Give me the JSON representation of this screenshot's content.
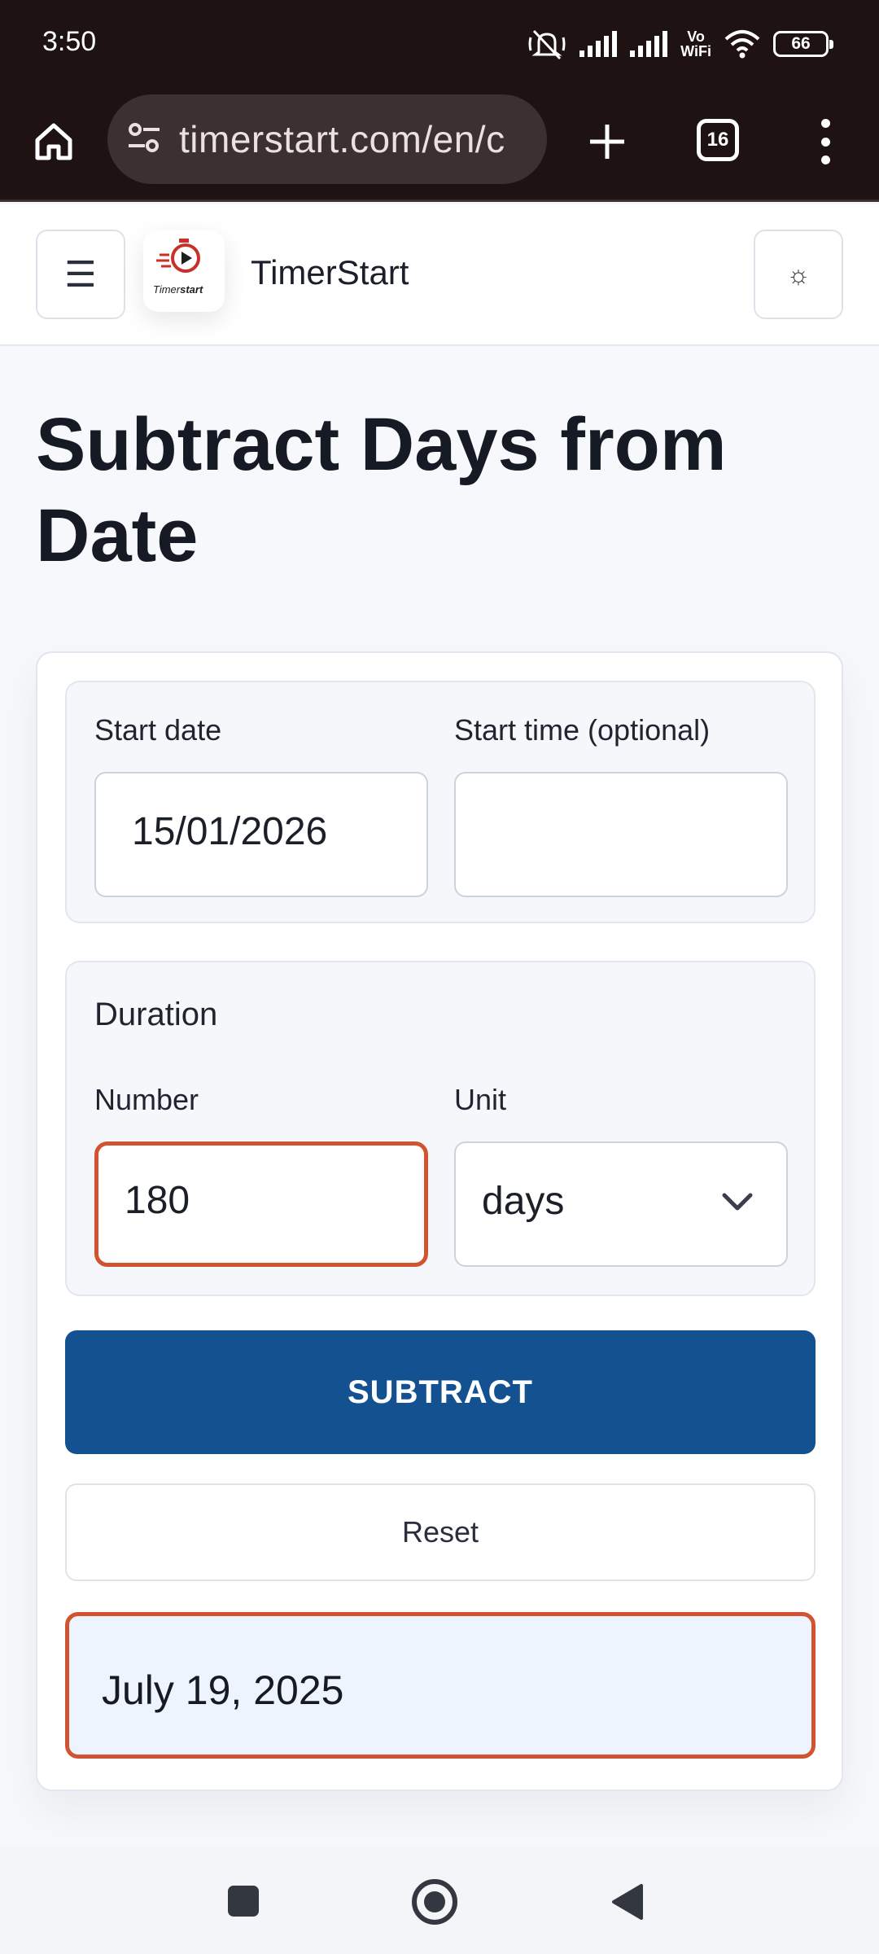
{
  "status_bar": {
    "time": "3:50",
    "network_label_top": "Vo",
    "network_label_bottom": "WiFi",
    "battery": "66",
    "icons": [
      "mute-icon",
      "signal-icon",
      "signal-icon",
      "wifi-icon",
      "battery-icon"
    ]
  },
  "browser": {
    "url": "timerstart.com/en/c",
    "tab_count": "16",
    "icons": [
      "home-icon",
      "tune-icon",
      "plus-icon",
      "tabs-icon",
      "more-vert-icon"
    ]
  },
  "header": {
    "menu_icon": "☰",
    "logo_text_light": "Timer",
    "logo_text_bold": "start",
    "brand": "TimerStart",
    "theme_icon": "☼"
  },
  "page": {
    "title": "Subtract Days from Date"
  },
  "form": {
    "start_date_label": "Start date",
    "start_date_value": "15/01/2026",
    "start_time_label": "Start time (optional)",
    "start_time_value": "",
    "duration_heading": "Duration",
    "number_label": "Number",
    "number_value": "180",
    "unit_label": "Unit",
    "unit_value": "days",
    "subtract_button": "SUBTRACT",
    "reset_button": "Reset",
    "result": "July 19, 2025"
  },
  "colors": {
    "primary": "#145190",
    "highlight": "#d2532f",
    "status_bg": "#1e1212",
    "result_bg": "#eef4fd"
  }
}
